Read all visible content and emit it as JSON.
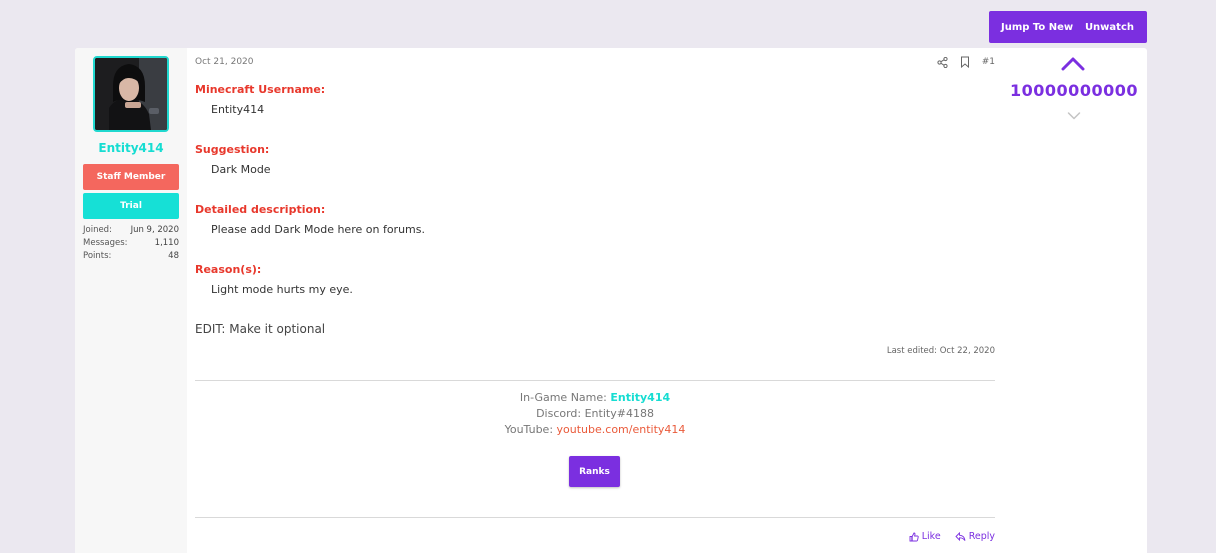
{
  "thread_actions": {
    "jump_to_new": "Jump To New",
    "unwatch": "Unwatch"
  },
  "user": {
    "avatar_icon": "user-avatar-photo",
    "name": "Entity414",
    "badges": {
      "staff": "Staff Member",
      "trial": "Trial"
    },
    "stats": [
      {
        "label": "Joined:",
        "value": "Jun 9, 2020"
      },
      {
        "label": "Messages:",
        "value": "1,110"
      },
      {
        "label": "Points:",
        "value": "48"
      }
    ]
  },
  "post": {
    "date": "Oct 21, 2020",
    "number": "#1",
    "fields": [
      {
        "label": "Minecraft Username:",
        "value": "Entity414"
      },
      {
        "label": "Suggestion:",
        "value": "Dark Mode"
      },
      {
        "label": "Detailed description:",
        "value": "Please add Dark Mode here on forums."
      },
      {
        "label": "Reason(s):",
        "value": "Light mode hurts my eye."
      }
    ],
    "edit_note": "EDIT: Make it optional",
    "last_edited": "Last edited: Oct 22, 2020"
  },
  "signature": {
    "ign_label": "In-Game Name:",
    "ign_value": "Entity414",
    "discord": "Discord: Entity#4188",
    "youtube_label": "YouTube:",
    "youtube_link": "youtube.com/entity414",
    "ranks_button": "Ranks"
  },
  "actions": {
    "like": "Like",
    "reply": "Reply"
  },
  "votes": {
    "count": "10000000000"
  },
  "colors": {
    "accent": "#7b2fe0",
    "username": "#16ddd2",
    "field_label": "#e8382c",
    "staff_badge": "#f4675e",
    "trial_badge": "#16e0d6",
    "background": "#ebe8f0"
  }
}
